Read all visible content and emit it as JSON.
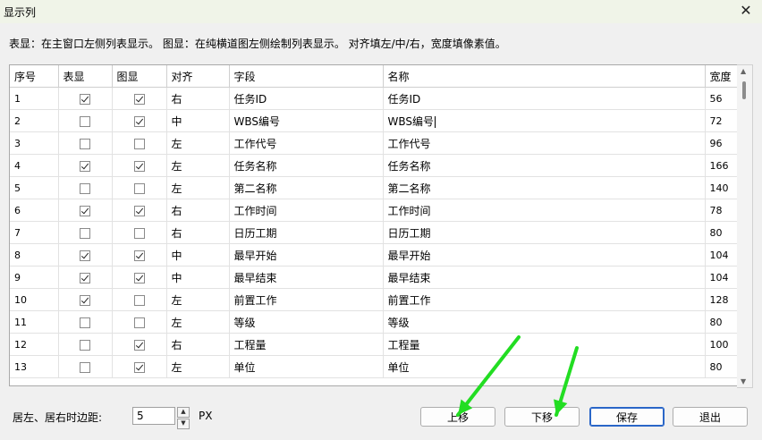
{
  "window": {
    "title": "显示列",
    "close_glyph": "✕"
  },
  "hint_text": "表显：在主窗口左侧列表显示。  图显：在纯横道图左侧绘制列表显示。  对齐填左/中/右，宽度填像素值。",
  "table": {
    "headers": [
      "序号",
      "表显",
      "图显",
      "对齐",
      "字段",
      "名称",
      "宽度"
    ],
    "rows": [
      {
        "num": "1",
        "table_show": true,
        "chart_show": true,
        "align": "右",
        "field": "任务ID",
        "name": "任务ID",
        "width": "56"
      },
      {
        "num": "2",
        "table_show": false,
        "chart_show": true,
        "align": "中",
        "field": "WBS编号",
        "name": "WBS编号",
        "width": "72"
      },
      {
        "num": "3",
        "table_show": false,
        "chart_show": false,
        "align": "左",
        "field": "工作代号",
        "name": "工作代号",
        "width": "96"
      },
      {
        "num": "4",
        "table_show": true,
        "chart_show": true,
        "align": "左",
        "field": "任务名称",
        "name": "任务名称",
        "width": "166"
      },
      {
        "num": "5",
        "table_show": false,
        "chart_show": false,
        "align": "左",
        "field": "第二名称",
        "name": "第二名称",
        "width": "140"
      },
      {
        "num": "6",
        "table_show": true,
        "chart_show": true,
        "align": "右",
        "field": "工作时间",
        "name": "工作时间",
        "width": "78"
      },
      {
        "num": "7",
        "table_show": false,
        "chart_show": false,
        "align": "右",
        "field": "日历工期",
        "name": "日历工期",
        "width": "80"
      },
      {
        "num": "8",
        "table_show": true,
        "chart_show": true,
        "align": "中",
        "field": "最早开始",
        "name": "最早开始",
        "width": "104"
      },
      {
        "num": "9",
        "table_show": true,
        "chart_show": true,
        "align": "中",
        "field": "最早结束",
        "name": "最早结束",
        "width": "104"
      },
      {
        "num": "10",
        "table_show": true,
        "chart_show": false,
        "align": "左",
        "field": "前置工作",
        "name": "前置工作",
        "width": "128"
      },
      {
        "num": "11",
        "table_show": false,
        "chart_show": false,
        "align": "左",
        "field": "等级",
        "name": "等级",
        "width": "80"
      },
      {
        "num": "12",
        "table_show": false,
        "chart_show": true,
        "align": "右",
        "field": "工程量",
        "name": "工程量",
        "width": "100"
      },
      {
        "num": "13",
        "table_show": false,
        "chart_show": true,
        "align": "左",
        "field": "单位",
        "name": "单位",
        "width": "80"
      }
    ]
  },
  "footer": {
    "margin_label": "居左、居右时边距:",
    "margin_value": "5",
    "margin_unit": "PX",
    "buttons": {
      "move_up": "上移",
      "move_down": "下移",
      "save": "保存",
      "exit": "退出"
    }
  },
  "colors": {
    "annotation_arrow": "#22dd22",
    "primary_button_border": "#2a66c8"
  }
}
